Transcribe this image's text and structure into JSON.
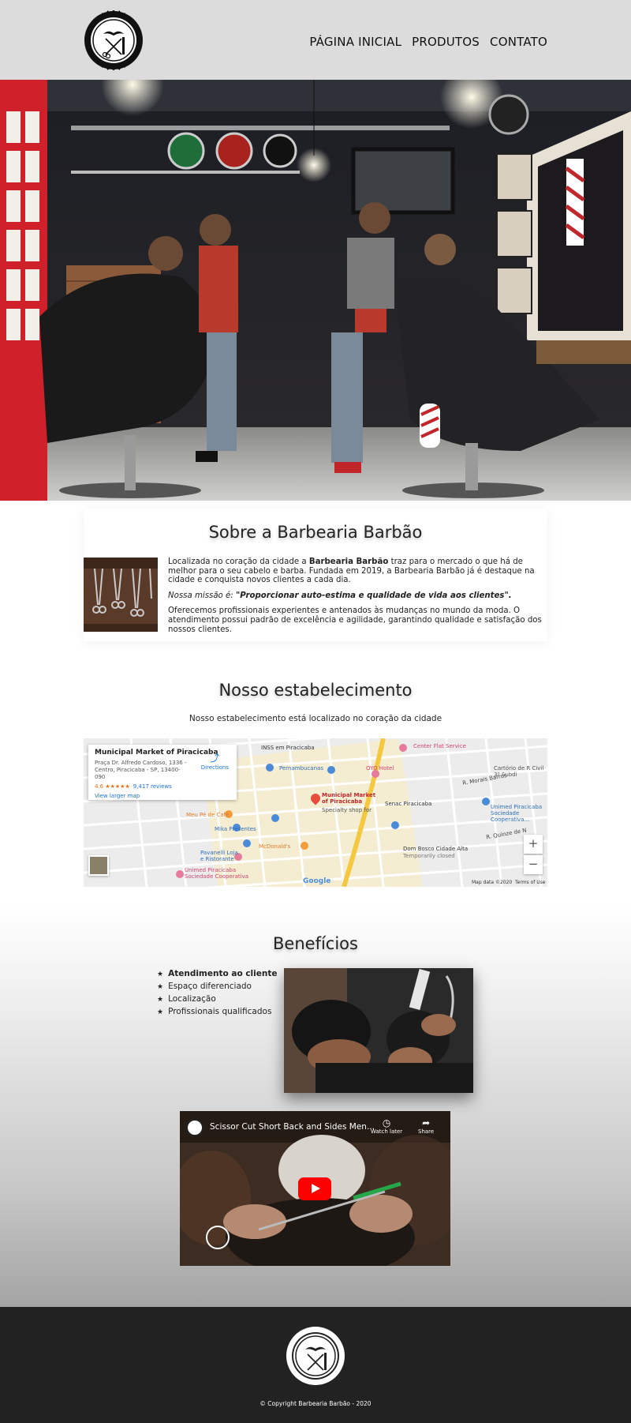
{
  "brand": {
    "name": "Barbearia Barbão"
  },
  "nav": [
    {
      "label": "PÁGINA INICIAL"
    },
    {
      "label": "PRODUTOS"
    },
    {
      "label": "CONTATO"
    }
  ],
  "about": {
    "title": "Sobre a Barbearia Barbão",
    "p1_before": "Localizada no coração da cidade a ",
    "p1_bold": "Barbearia Barbão",
    "p1_after": " traz para o mercado o que há de melhor para o seu cabelo e barba. Fundada em 2019, a Barbearia Barbão já é destaque na cidade e conquista novos clientes a cada dia.",
    "mission_label": "Nossa missão é: ",
    "mission_text": "\"Proporcionar auto-estima e qualidade de vida aos clientes\".",
    "p3": "Oferecemos profissionais experientes e antenados às mudanças no mundo da moda. O atendimento possui padrão de excelência e agilidade, garantindo qualidade e satisfação dos nossos clientes."
  },
  "establishment": {
    "title": "Nosso estabelecimento",
    "subtitle": "Nosso estabelecimento está localizado no coração da cidade"
  },
  "map": {
    "place_name": "Municipal Market of Piracicaba",
    "address": "Praça Dr. Alfredo Cardoso, 1336 - Centro, Piracicaba - SP, 13400-090",
    "rating": "4.6 ★★★★★",
    "reviews": "9,417 reviews",
    "directions": "Directions",
    "view_larger": "View larger map",
    "labels": {
      "inss": "INSS em Piracicaba",
      "center_flat": "Center Flat Service",
      "pernambucanas": "Pernambucanas",
      "oyo": "OYO Hotel",
      "cartorio": "Cartório de R Civil 3º Subdi",
      "market": "Municipal Market of Piracicaba",
      "market_sub": "Specialty shop for",
      "senac": "Senac Piracicaba",
      "unimed_coop": "Unimed Piracicaba Sociedade Cooperativa...",
      "meu_pe": "Meu Pé de Café",
      "mika": "Mika Presentes",
      "mcdonalds": "McDonald's",
      "dom_bosco": "Dom Bosco Cidade Alta",
      "dom_bosco_sub": "Temporarily closed",
      "pavanelli": "Pavanelli Loja e Ristorante",
      "unimed": "Unimed Piracicaba Sociedade Cooperativa",
      "street_morais": "R. Morais Barros",
      "street_quinze": "R. Quinze de N"
    },
    "zoom_in": "+",
    "zoom_out": "−",
    "google": "Google",
    "map_data": "Map data ©2020",
    "terms": "Terms of Use"
  },
  "benefits": {
    "title": "Benefícios",
    "items": [
      "Atendimento ao cliente",
      "Espaço diferenciado",
      "Localização",
      "Profissionais qualificados"
    ]
  },
  "video": {
    "title": "Scissor Cut Short Back and Sides Men...",
    "watch_later": "Watch later",
    "share": "Share"
  },
  "footer": {
    "copyright": "© Copyright Barbearia Barbão - 2020"
  },
  "colors": {
    "header_bg": "#dcdcdc",
    "footer_bg": "#222222",
    "youtube_red": "#ff0000",
    "hero_phone_red": "#d0212b"
  }
}
